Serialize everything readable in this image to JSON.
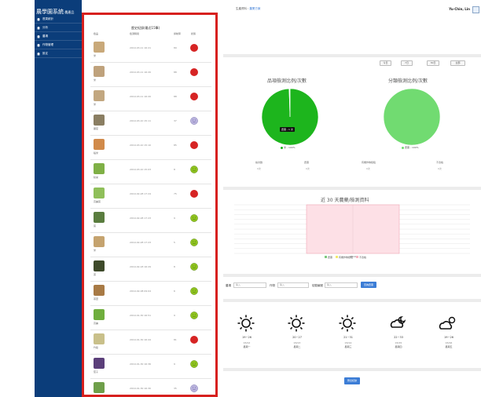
{
  "sidebar": {
    "brand": "農學園系統",
    "brand_sub": "-農產品",
    "items": [
      {
        "label": "首頁統計",
        "icon": "home-icon"
      },
      {
        "label": "分析",
        "icon": "home-icon"
      },
      {
        "label": "農場",
        "icon": "home-icon"
      },
      {
        "label": "作物管理",
        "icon": "home-icon"
      },
      {
        "label": "設定",
        "icon": "home-icon"
      }
    ]
  },
  "topbar": {
    "left_text": "生產資料 :",
    "left_link": "農業方案",
    "user": "Yu-Chin, Lin"
  },
  "records": {
    "title": "歷史紀錄(最近15筆)",
    "columns": [
      "檢品",
      "檢測時間",
      "抑制率",
      "狀態"
    ],
    "rows": [
      {
        "name": "米",
        "time": "2019-03-11 16:21",
        "value": "89",
        "status": "red",
        "thumb": "#c9a97a"
      },
      {
        "name": "米",
        "time": "2019-03-11 16:20",
        "value": "88",
        "status": "red",
        "thumb": "#bfa27c"
      },
      {
        "name": "米",
        "time": "2019-03-11 16:20",
        "value": "88",
        "status": "red",
        "thumb": "#c2a780"
      },
      {
        "name": "蘿蔔",
        "time": "2019-03-10 15:11",
        "value": "37",
        "status": "purple",
        "thumb": "#8a7e62"
      },
      {
        "name": "稻米",
        "time": "2019-03-10 15:10",
        "value": "85",
        "status": "red",
        "thumb": "#d18a4a"
      },
      {
        "name": "秋葵",
        "time": "2019-03-10 15:03",
        "value": "8",
        "status": "green",
        "thumb": "#7fb046"
      },
      {
        "name": "高麗菜",
        "time": "2019-02-28 17:24",
        "value": "75",
        "status": "red",
        "thumb": "#8fbf5a"
      },
      {
        "name": "菜",
        "time": "2019-02-28 17:23",
        "value": "9",
        "status": "green",
        "thumb": "#5a7d3f"
      },
      {
        "name": "米",
        "time": "2019-02-28 17:23",
        "value": "5",
        "status": "green",
        "thumb": "#c5a36f"
      },
      {
        "name": "茶",
        "time": "2019-02-18 16:29",
        "value": "8",
        "status": "green",
        "thumb": "#3e4a2a"
      },
      {
        "name": "茶葉",
        "time": "2019-02-08 09:04",
        "value": "6",
        "status": "green",
        "thumb": "#a87a45"
      },
      {
        "name": "高麗",
        "time": "2019-01-30 16:51",
        "value": "9",
        "status": "green",
        "thumb": "#6fae3d"
      },
      {
        "name": "竹筍",
        "time": "2019-01-30 16:44",
        "value": "81",
        "status": "red",
        "thumb": "#c9c08a"
      },
      {
        "name": "茄子",
        "time": "2019-01-30 16:36",
        "value": "9",
        "status": "green",
        "thumb": "#5b3f7a"
      },
      {
        "name": "菜",
        "time": "2019-01-30 16:30",
        "value": "35",
        "status": "purple",
        "thumb": "#6f9f4a"
      }
    ]
  },
  "cards": [
    {
      "label": "檢測次數",
      "value": "110",
      "color": "#29b3e8"
    },
    {
      "label": "農藥",
      "value": "44",
      "color": "#9ccb21"
    },
    {
      "label": "有機作物檢驗",
      "value": "5",
      "color": "#8c3fb0"
    },
    {
      "label": "不合格",
      "value": "61",
      "color": "#f04a45"
    }
  ],
  "range_buttons": [
    "今日",
    "7日",
    "30日",
    "全部"
  ],
  "chart_data": [
    {
      "type": "pie",
      "title": "品項檢測比例/次數",
      "categories": [
        "米",
        "其他"
      ],
      "values": [
        99.5,
        0.5
      ],
      "colors": [
        "#1db51d",
        "#ffffff"
      ],
      "legend": [
        "米 - 100%"
      ],
      "tooltip": "農藥 - 1 次"
    },
    {
      "type": "pie",
      "title": "分類檢測比例/次數",
      "categories": [
        "農藥"
      ],
      "values": [
        100
      ],
      "colors": [
        "#71db71"
      ],
      "legend": [
        "農藥 - 100%"
      ]
    },
    {
      "type": "bar",
      "title": "近 30 天農藥/檢測資料",
      "categories": [
        "2019"
      ],
      "series": [
        {
          "name": "農藥",
          "values": [
            100
          ],
          "color": "#7fc97f"
        },
        {
          "name": "有機作物檢驗",
          "values": [
            0
          ],
          "color": "#f3e96b"
        },
        {
          "name": "不合格",
          "values": [
            100
          ],
          "color": "#f5b5c0"
        }
      ],
      "ylim": [
        0,
        100
      ]
    }
  ],
  "mini_stats": [
    {
      "label": "總次數",
      "value": "0次"
    },
    {
      "label": "農藥",
      "value": "0次"
    },
    {
      "label": "有機作物檢驗",
      "value": "0次"
    },
    {
      "label": "不合格",
      "value": "0次"
    }
  ],
  "search": {
    "fields": [
      {
        "label": "農場",
        "placeholder": "輸入"
      },
      {
        "label": "作物",
        "placeholder": "輸入"
      },
      {
        "label": "檢驗編號",
        "placeholder": "輸入"
      }
    ],
    "button": "查詢農藥"
  },
  "weather": [
    {
      "temp": "19~26",
      "date": "03/12",
      "day": "星期一",
      "icon": "sun-icon"
    },
    {
      "temp": "20~27",
      "date": "03/13",
      "day": "星期二",
      "icon": "sun-icon"
    },
    {
      "temp": "21~31",
      "date": "03/14",
      "day": "星期三",
      "icon": "sun-icon"
    },
    {
      "temp": "22~33",
      "date": "03/15",
      "day": "星期四",
      "icon": "moon-cloud-icon"
    },
    {
      "temp": "19~26",
      "date": "03/16",
      "day": "星期五",
      "icon": "cloud-sun-icon"
    }
  ],
  "footer_button": "匯出紀錄"
}
